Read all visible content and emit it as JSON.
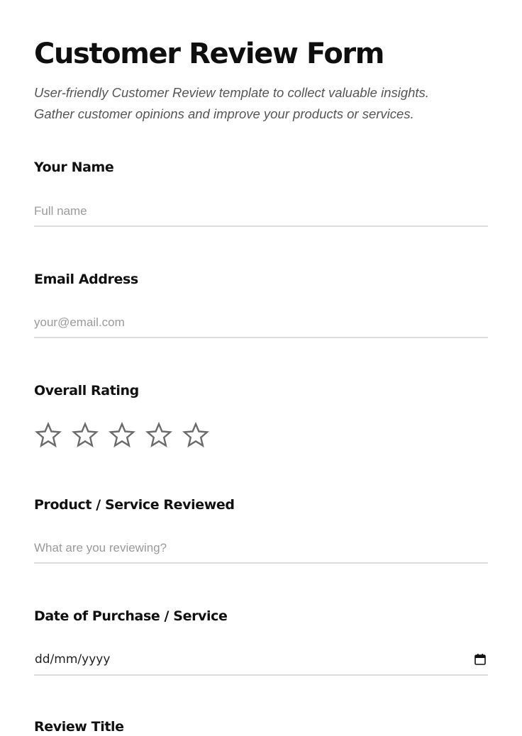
{
  "form": {
    "title": "Customer Review Form",
    "subtitle_line1": "User-friendly Customer Review template to collect valuable insights.",
    "subtitle_line2": "Gather customer opinions and improve your products or services."
  },
  "fields": {
    "name": {
      "label": "Your Name",
      "placeholder": "Full name",
      "value": ""
    },
    "email": {
      "label": "Email Address",
      "placeholder": "your@email.com",
      "value": ""
    },
    "rating": {
      "label": "Overall Rating",
      "max": 5,
      "value": 0,
      "icon": "star-outline-icon"
    },
    "product": {
      "label": "Product / Service Reviewed",
      "placeholder": "What are you reviewing?",
      "value": ""
    },
    "date": {
      "label": "Date of Purchase / Service",
      "placeholder": "dd/mm/yyyy",
      "icon": "calendar-icon"
    },
    "review_title": {
      "label": "Review Title"
    }
  },
  "colors": {
    "title_highlight": "#fdf0c4",
    "star_outline": "#6b6b6b",
    "input_border": "#dcdcdc",
    "placeholder": "#9a9a9a"
  }
}
